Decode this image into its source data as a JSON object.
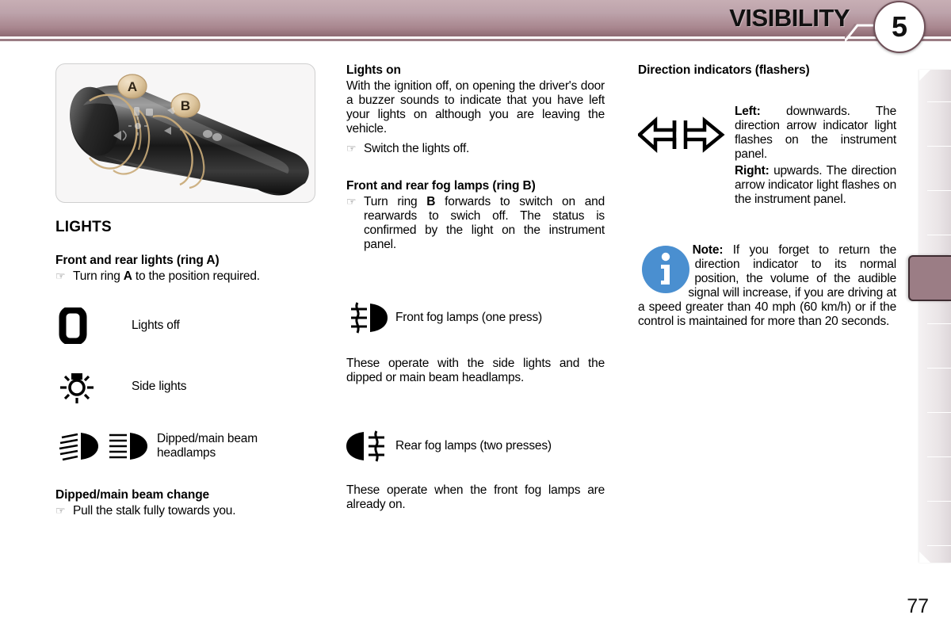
{
  "header": {
    "title": "VISIBILITY",
    "chapter_number": "5",
    "accent_color": "#9b7d85",
    "banner_gradient_top": "#c7aeb4",
    "banner_gradient_bottom": "#8d6a73"
  },
  "page_number": "77",
  "figure": {
    "caption_labels": [
      "A",
      "B"
    ],
    "alt": "Multifunction lighting control stalk with rotating ring A and ring B"
  },
  "left_column": {
    "section_title": "LIGHTS",
    "subsection_1": {
      "heading": "Front and rear lights (ring A)",
      "bullet": {
        "pre": "Turn ring ",
        "bold": "A",
        "post": " to the position required."
      }
    },
    "symbols": [
      {
        "icon": "lights-off-icon",
        "label": "Lights off"
      },
      {
        "icon": "side-lights-icon",
        "label": "Side lights"
      },
      {
        "icon": "dipped-main-beam-headlamps-icon",
        "label": "Dipped/main beam headlamps"
      }
    ],
    "subsection_2": {
      "heading": "Dipped/main beam change",
      "bullet": "Pull the stalk fully towards you."
    }
  },
  "middle_column": {
    "subsection_1": {
      "heading": "Lights on",
      "body": "With the ignition off, on opening the driver's door a buzzer sounds to indicate that you have left your lights on although you are leaving the vehicle.",
      "bullet": "Switch the lights off."
    },
    "subsection_2": {
      "heading": "Front and rear fog lamps (ring B)",
      "bullet": {
        "pre": "Turn ring ",
        "bold": "B",
        "post": " forwards to switch on and rearwards to swich off. The status is confirmed by the light on the instrument panel."
      }
    },
    "front_fog": {
      "icon": "front-fog-lamps-icon",
      "label": "Front fog lamps (one press)",
      "body": "These operate with the side lights and the dipped or main beam headlamps."
    },
    "rear_fog": {
      "icon": "rear-fog-lamps-icon",
      "label": "Rear fog lamps (two presses)",
      "body": "These operate when the front fog lamps are already on."
    }
  },
  "right_column": {
    "heading": "Direction indicators (flashers)",
    "icons": [
      "left-arrow-icon",
      "right-arrow-icon"
    ],
    "left": {
      "label": "Left:",
      "text": " downwards. The direction arrow indicator light flashes on the instrument panel."
    },
    "right": {
      "label": "Right:",
      "text": " upwards. The direction arrow indicator light flashes on the instrument panel."
    },
    "note": {
      "icon": "info-icon",
      "icon_color": "#4a8fd0",
      "label": "Note:",
      "text": " If you forget to return the direction indicator to its normal position, the volume of the audible signal will increase, if you are driving at a speed greater than 40 mph (60 km/h) or if the control is maintained for more than 20 seconds."
    }
  }
}
